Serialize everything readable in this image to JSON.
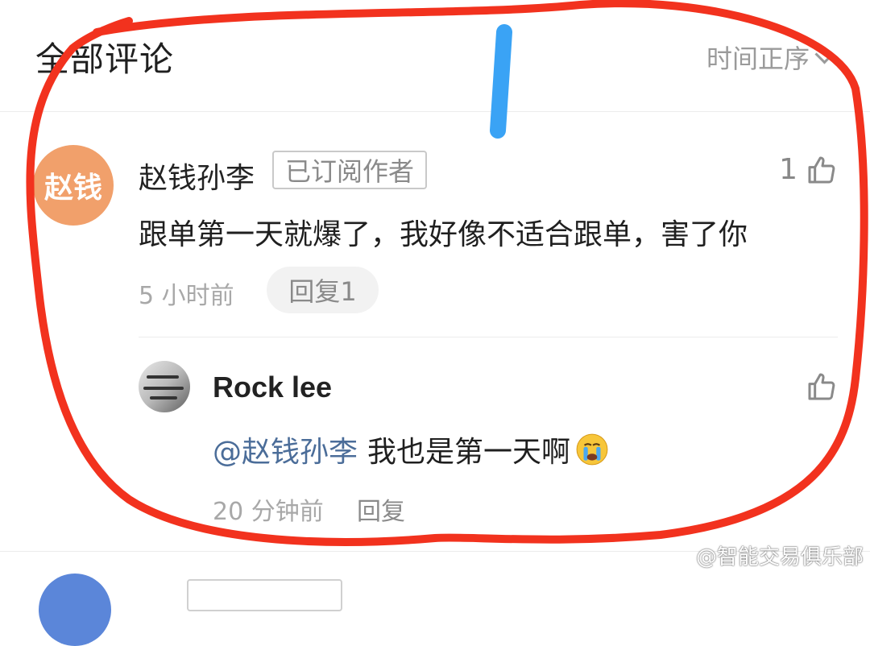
{
  "header": {
    "title": "全部评论",
    "sort_label": "时间正序"
  },
  "comment": {
    "avatar_text": "赵钱",
    "author": "赵钱孙李",
    "badge": "已订阅作者",
    "like_count": "1",
    "text": "跟单第一天就爆了，我好像不适合跟单，害了你",
    "time": "5 小时前",
    "reply_button": "回复1"
  },
  "reply": {
    "author": "Rock lee",
    "mention": "@赵钱孙李",
    "text": "我也是第一天啊",
    "emoji": "crying-face",
    "time": "20 分钟前",
    "reply_link": "回复"
  },
  "watermark": "@智能交易俱乐部",
  "colors": {
    "annotation_red": "#f2321e",
    "annotation_blue": "#3aa3f5",
    "avatar_orange": "#f1a06b",
    "mention_blue": "#4b6d99"
  }
}
